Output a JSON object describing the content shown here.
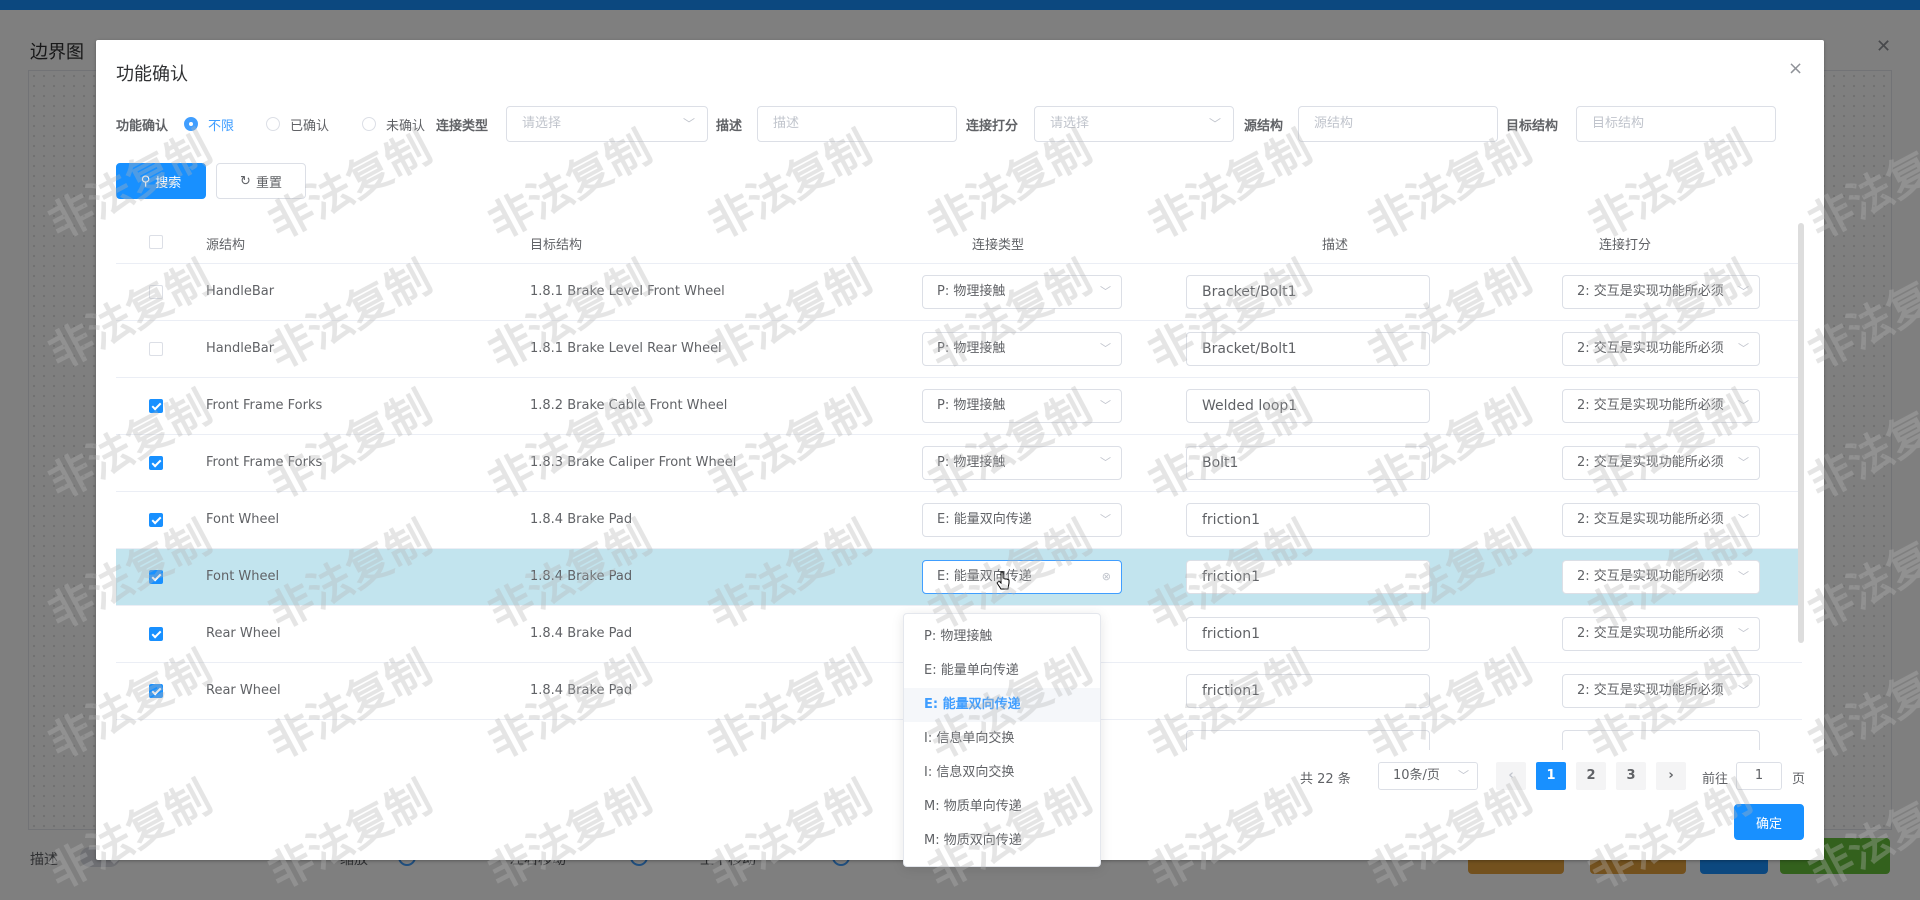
{
  "background": {
    "title": "边界图",
    "close_icon": "✕",
    "bottom": {
      "desc_label": "描述",
      "scale_label": "缩放",
      "lr_label": "左右移动",
      "ud_label": "上下移动",
      "btn_colors": [
        "#e6a23c",
        "#e6a23c",
        "#1890ff",
        "#67c23a"
      ]
    }
  },
  "dialog": {
    "title": "功能确认",
    "close_icon": "×",
    "filters": {
      "confirm_label": "功能确认",
      "radios": [
        "不限",
        "已确认",
        "未确认"
      ],
      "conn_type_label": "连接类型",
      "conn_type_placeholder": "请选择",
      "desc_label": "描述",
      "desc_placeholder": "描述",
      "score_label": "连接打分",
      "score_placeholder": "请选择",
      "src_label": "源结构",
      "src_placeholder": "源结构",
      "tgt_label": "目标结构",
      "tgt_placeholder": "目标结构"
    },
    "buttons": {
      "search": "搜索",
      "reset": "重置",
      "confirm": "确定"
    },
    "table": {
      "headers": [
        "源结构",
        "目标结构",
        "连接类型",
        "描述",
        "连接打分"
      ],
      "rows": [
        {
          "checked": false,
          "src": "HandleBar",
          "tgt": "1.8.1 Brake Level Front Wheel",
          "type": "P: 物理接触",
          "desc": "Bracket/Bolt1",
          "score": "2: 交互是实现功能所必须"
        },
        {
          "checked": false,
          "src": "HandleBar",
          "tgt": "1.8.1 Brake Level Rear Wheel",
          "type": "P: 物理接触",
          "desc": "Bracket/Bolt1",
          "score": "2: 交互是实现功能所必须"
        },
        {
          "checked": true,
          "src": "Front Frame Forks",
          "tgt": "1.8.2 Brake Cable Front Wheel",
          "type": "P: 物理接触",
          "desc": "Welded loop1",
          "score": "2: 交互是实现功能所必须"
        },
        {
          "checked": true,
          "src": "Front Frame Forks",
          "tgt": "1.8.3 Brake Caliper Front Wheel",
          "type": "P: 物理接触",
          "desc": "Bolt1",
          "score": "2: 交互是实现功能所必须"
        },
        {
          "checked": true,
          "src": "Font Wheel",
          "tgt": "1.8.4 Brake Pad",
          "type": "E: 能量双向传递",
          "desc": "friction1",
          "score": "2: 交互是实现功能所必须"
        },
        {
          "checked": true,
          "src": "Font Wheel",
          "tgt": "1.8.4 Brake Pad",
          "type": "E: 能量双向传递",
          "desc": "friction1",
          "score": "2: 交互是实现功能所必须"
        },
        {
          "checked": true,
          "src": "Rear Wheel",
          "tgt": "1.8.4 Brake Pad",
          "type": "",
          "desc": "friction1",
          "score": "2: 交互是实现功能所必须"
        },
        {
          "checked": true,
          "src": "Rear Wheel",
          "tgt": "1.8.4 Brake Pad",
          "type": "",
          "desc": "friction1",
          "score": "2: 交互是实现功能所必须"
        }
      ]
    },
    "dropdown": {
      "options": [
        "P: 物理接触",
        "E: 能量单向传递",
        "E: 能量双向传递",
        "I: 信息单向交换",
        "I: 信息双向交换",
        "M: 物质单向传递",
        "M: 物质双向传递"
      ],
      "selected_index": 2
    },
    "pagination": {
      "total_text": "共 22 条",
      "page_size": "10条/页",
      "pages": [
        "1",
        "2",
        "3"
      ],
      "current": "1",
      "goto_label": "前往",
      "goto_value": "1",
      "page_suffix": "页"
    }
  },
  "watermark": "非法复制",
  "colors": {
    "primary": "#1890ff",
    "highlight_row": "#c2e4ee"
  }
}
